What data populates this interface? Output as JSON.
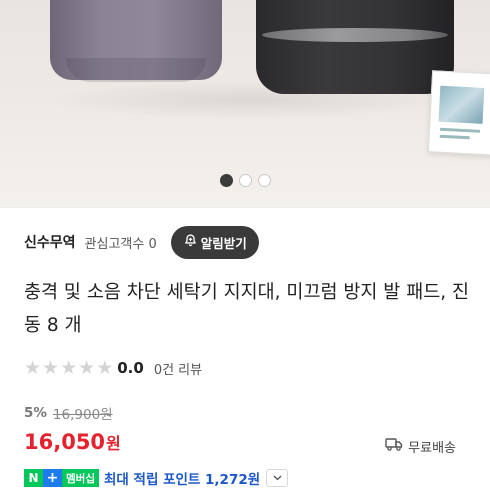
{
  "gallery": {
    "dot_count": 3,
    "active_index": 0
  },
  "store": {
    "name": "신수무역",
    "interest": "관심고객수 0",
    "alert_label": "알림받기"
  },
  "product": {
    "title": "충격 및 소음 차단 세탁기 지지대, 미끄럼 방지 발 패드, 진동 8 개"
  },
  "rating": {
    "stars_filled": 0,
    "stars_total": 5,
    "score": "0.0",
    "review_count": "0건 리뷰"
  },
  "pricing": {
    "discount": "5%",
    "original_price": "16,900원",
    "sale_price": "16,050",
    "currency_unit": "원"
  },
  "shipping": {
    "label": "무료배송"
  },
  "membership": {
    "n_label": "N",
    "plus_label": "+",
    "badge_label": "멤버십",
    "points_text": "최대 적립 포인트 1,272원"
  },
  "colors": {
    "price": "#e5222e",
    "points": "#1d57c9",
    "naver_green": "#03c75a",
    "plus_blue": "#1e7cf2",
    "alert_button": "#3a3a3a"
  },
  "icons": {
    "alert": "bell-plus-icon",
    "shipping": "delivery-truck-icon",
    "toggle": "chevron-down-icon",
    "star": "star-icon"
  }
}
